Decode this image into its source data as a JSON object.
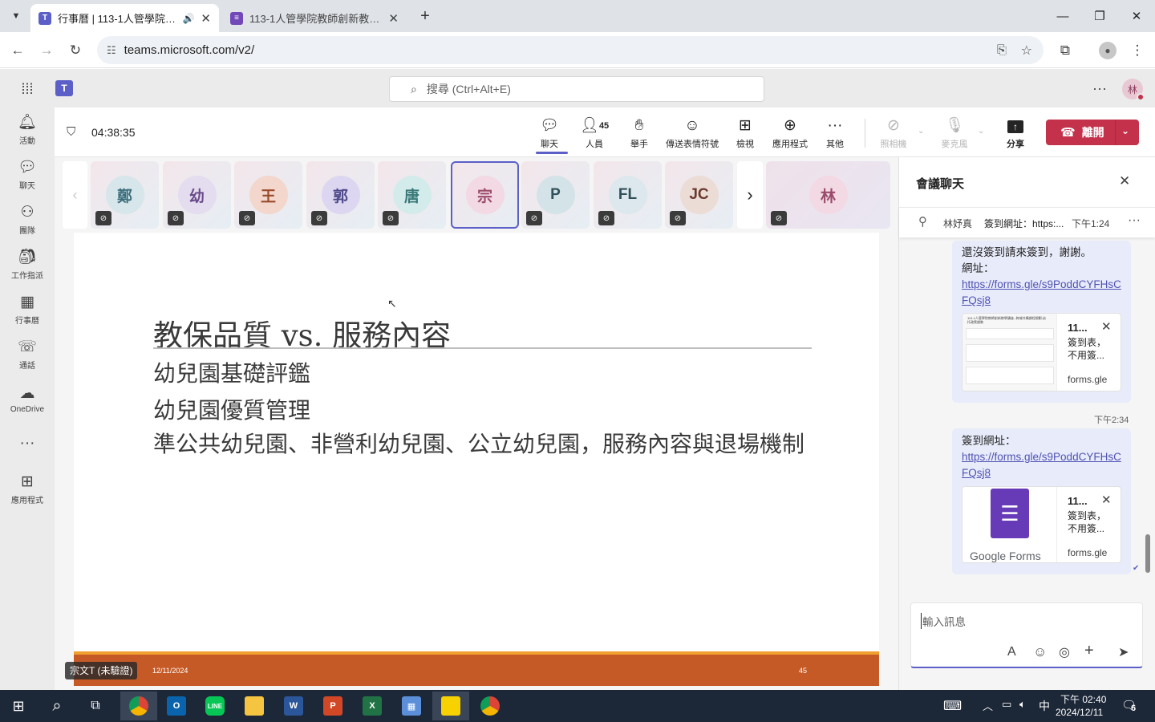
{
  "browser": {
    "tabs": [
      {
        "title": "行事曆 | 113-1人管學院教師",
        "active": true
      },
      {
        "title": "113-1人管學院教師創新教學講",
        "active": false
      }
    ],
    "url": "teams.microsoft.com/v2/"
  },
  "teams": {
    "search_placeholder": "搜尋 (Ctrl+Alt+E)",
    "avatar_initial": "林",
    "rail": [
      {
        "label": "活動",
        "icon": "bell-icon"
      },
      {
        "label": "聊天",
        "icon": "chat-icon"
      },
      {
        "label": "團隊",
        "icon": "teams-icon"
      },
      {
        "label": "工作指派",
        "icon": "assignments-icon"
      },
      {
        "label": "行事曆",
        "icon": "calendar-icon"
      },
      {
        "label": "通話",
        "icon": "phone-icon"
      },
      {
        "label": "OneDrive",
        "icon": "cloud-icon"
      },
      {
        "label": "應用程式",
        "icon": "apps-icon"
      }
    ]
  },
  "meeting": {
    "timer": "04:38:35",
    "people_count": "45",
    "toolbar": {
      "chat": "聊天",
      "people": "人員",
      "raise": "舉手",
      "react": "傳送表情符號",
      "view": "檢視",
      "apps": "應用程式",
      "more": "其他",
      "camera": "照相機",
      "mic": "麥克風",
      "share": "分享",
      "leave": "離開"
    },
    "participants": [
      "鄭",
      "幼",
      "王",
      "郭",
      "唐",
      "宗",
      "P",
      "FL",
      "JC"
    ],
    "pinned_participant": "林",
    "speaker_label": "宗文T (未驗證)"
  },
  "slide": {
    "title": "教保品質 vs. 服務內容",
    "bullets": [
      "幼兒園基礎評鑑",
      "幼兒園優質管理",
      "準公共幼兒園、非營利幼兒園、公立幼兒園，服務內容與退場機制"
    ],
    "date": "12/11/2024",
    "page": "45",
    "footer_color": "#c55a26"
  },
  "chat": {
    "title": "會議聊天",
    "pinned": {
      "sender": "林妤真",
      "text": "簽到網址：https:...",
      "time": "下午1:24"
    },
    "messages": [
      {
        "text": "還沒簽到請來簽到，謝謝。",
        "label": "網址：",
        "link": "https://forms.gle/s9PoddCYFHsCFQsj8",
        "card": {
          "title": "11...",
          "desc": "簽到表，不用簽...",
          "domain": "forms.gle",
          "thumb_title": "113-1人管學院教師創新教學講座--跨域共構課程規劃-幼托政策趨勢"
        }
      },
      {
        "time": "下午2:34",
        "label": "簽到網址：",
        "link": "https://forms.gle/s9PoddCYFHsCFQsj8",
        "card": {
          "title": "11...",
          "desc": "簽到表，不用簽...",
          "domain": "forms.gle",
          "brand": "Google Forms"
        }
      }
    ],
    "input_placeholder": "輸入訊息"
  },
  "taskbar": {
    "time": "下午 02:40",
    "date": "2024/12/11",
    "ime": "中",
    "notif": "6"
  }
}
